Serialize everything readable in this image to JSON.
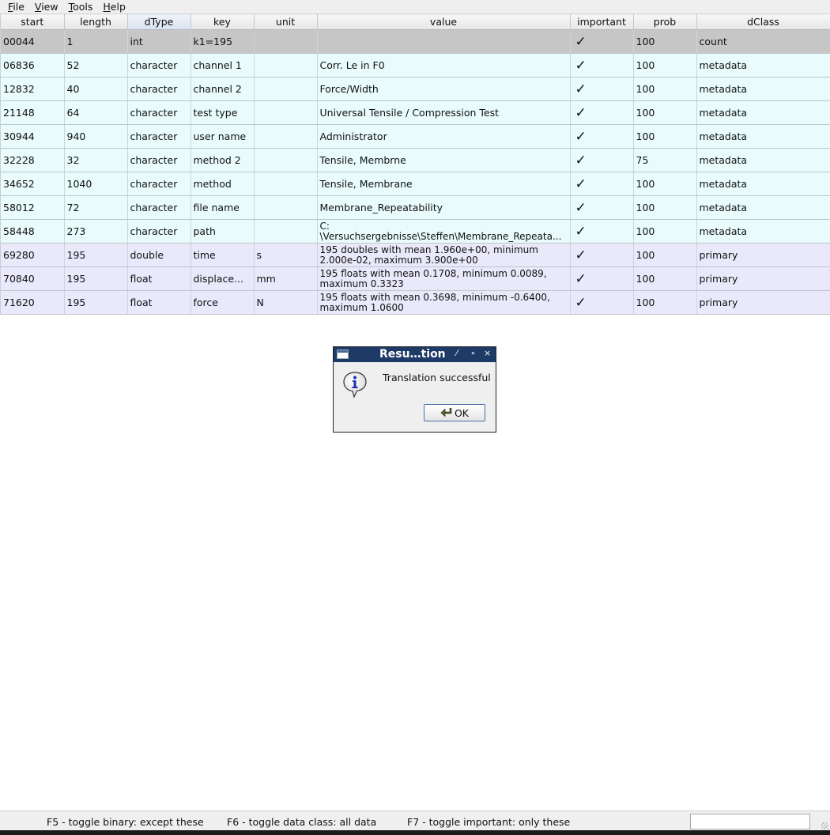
{
  "menu": {
    "items": [
      {
        "pre": "",
        "ul": "F",
        "post": "ile"
      },
      {
        "pre": "",
        "ul": "V",
        "post": "iew"
      },
      {
        "pre": "",
        "ul": "T",
        "post": "ools"
      },
      {
        "pre": "",
        "ul": "H",
        "post": "elp"
      }
    ]
  },
  "table": {
    "columns": [
      "start",
      "length",
      "dType",
      "key",
      "unit",
      "value",
      "important",
      "prob",
      "dClass"
    ],
    "sorted_column": "dType",
    "rows": [
      {
        "start": "00044",
        "length": "1",
        "dtype": "int",
        "key": "k1=195",
        "unit": "",
        "value": "",
        "important": "✓",
        "prob": "100",
        "dclass": "count",
        "kind": "sel"
      },
      {
        "start": "06836",
        "length": "52",
        "dtype": "character",
        "key": "channel 1",
        "unit": "",
        "value": "Corr. Le in F0",
        "important": "✓",
        "prob": "100",
        "dclass": "metadata",
        "kind": "meta"
      },
      {
        "start": "12832",
        "length": "40",
        "dtype": "character",
        "key": "channel 2",
        "unit": "",
        "value": "Force/Width",
        "important": "✓",
        "prob": "100",
        "dclass": "metadata",
        "kind": "meta"
      },
      {
        "start": "21148",
        "length": "64",
        "dtype": "character",
        "key": "test type",
        "unit": "",
        "value": "Universal Tensile / Compression Test",
        "important": "✓",
        "prob": "100",
        "dclass": "metadata",
        "kind": "meta"
      },
      {
        "start": "30944",
        "length": "940",
        "dtype": "character",
        "key": "user name",
        "unit": "",
        "value": "Administrator",
        "important": "✓",
        "prob": "100",
        "dclass": "metadata",
        "kind": "meta"
      },
      {
        "start": "32228",
        "length": "32",
        "dtype": "character",
        "key": "method 2",
        "unit": "",
        "value": "Tensile, Membrne",
        "important": "✓",
        "prob": "75",
        "dclass": "metadata",
        "kind": "meta"
      },
      {
        "start": "34652",
        "length": "1040",
        "dtype": "character",
        "key": "method",
        "unit": "",
        "value": "Tensile, Membrane",
        "important": "✓",
        "prob": "100",
        "dclass": "metadata",
        "kind": "meta"
      },
      {
        "start": "58012",
        "length": "72",
        "dtype": "character",
        "key": "file name",
        "unit": "",
        "value": "Membrane_Repeatability",
        "important": "✓",
        "prob": "100",
        "dclass": "metadata",
        "kind": "meta"
      },
      {
        "start": "58448",
        "length": "273",
        "dtype": "character",
        "key": "path",
        "unit": "",
        "value": "C: \\Versuchsergebnisse\\Steffen\\Membrane_Repeata...",
        "important": "✓",
        "prob": "100",
        "dclass": "metadata",
        "kind": "meta"
      },
      {
        "start": "69280",
        "length": "195",
        "dtype": "double",
        "key": "time",
        "unit": "s",
        "value": "195 doubles with mean 1.960e+00, minimum 2.000e-02, maximum 3.900e+00",
        "important": "✓",
        "prob": "100",
        "dclass": "primary",
        "kind": "prim"
      },
      {
        "start": "70840",
        "length": "195",
        "dtype": "float",
        "key": "displace...",
        "unit": "mm",
        "value": "195 floats with mean 0.1708, minimum 0.0089, maximum 0.3323",
        "important": "✓",
        "prob": "100",
        "dclass": "primary",
        "kind": "prim"
      },
      {
        "start": "71620",
        "length": "195",
        "dtype": "float",
        "key": "force",
        "unit": "N",
        "value": "195 floats with mean 0.3698, minimum -0.6400, maximum 1.0600",
        "important": "✓",
        "prob": "100",
        "dclass": "primary",
        "kind": "prim"
      }
    ]
  },
  "dialog": {
    "title": "Resu…tion",
    "controls": [
      "⁄",
      "∘",
      "×"
    ],
    "message": "Translation successful",
    "ok_label": "OK",
    "icon": "info-icon"
  },
  "status": {
    "f5": "F5 - toggle binary: except these",
    "f6": "F6 - toggle data class: all data",
    "f7": "F7 - toggle important: only these",
    "search_value": ""
  },
  "colors": {
    "titlebar": "#1e3a66",
    "row_selected": "#c6c6c6",
    "row_metadata": "#e9fbfb",
    "row_primary": "#e9e9fb"
  }
}
